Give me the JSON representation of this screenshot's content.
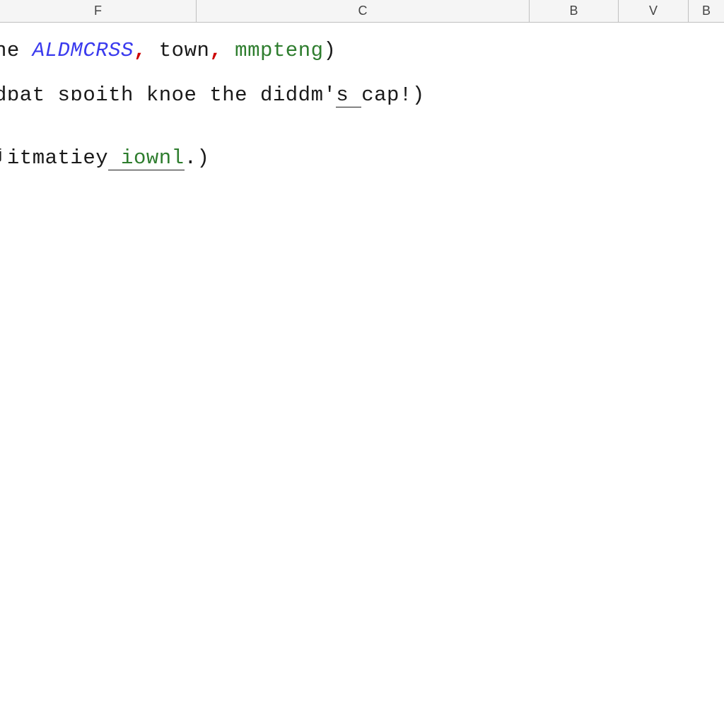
{
  "columns": {
    "F": "F",
    "C": "C",
    "B1": "B",
    "V": "V",
    "B2": "B"
  },
  "code": {
    "line1": {
      "p1": "ne ",
      "p2": "ALDMCRSS",
      "p3": ",",
      "p4": " town",
      "p5": ",",
      "p6": " mmpteng",
      "p7": ")"
    },
    "line2": {
      "p1": "dɒat sɒoith knoe the diddm'",
      "p2": "s ",
      "p3": "cap!)"
    },
    "line3": {
      "p1": "ʲitmatiey",
      "p2": " iownl",
      "p3": ".)"
    }
  }
}
